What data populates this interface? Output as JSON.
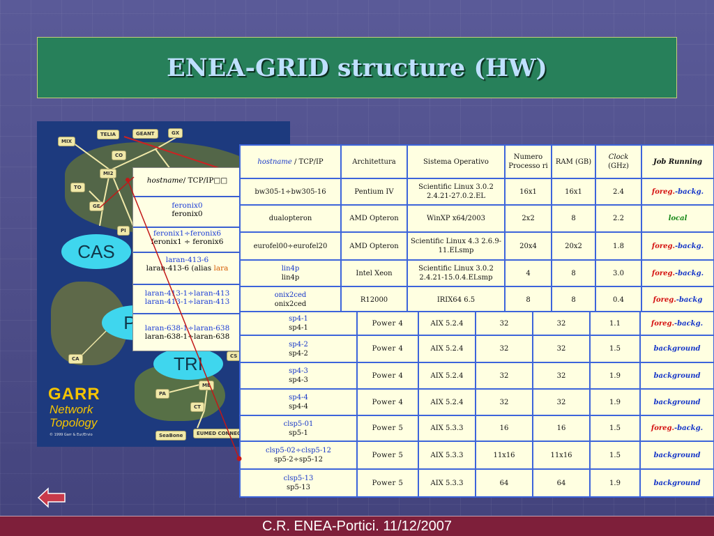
{
  "title": "ENEA-GRID structure (HW)",
  "footer": "C.R. ENEA-Portici. 11/12/2007",
  "map": {
    "nodes": [
      "MIX",
      "TELIA",
      "GEANT",
      "GX",
      "CO",
      "MI2",
      "TO",
      "GE",
      "PI",
      "CA",
      "CS",
      "PA",
      "ME",
      "CT",
      "SeaBone",
      "EUMED CONNECT"
    ],
    "clouds": [
      "CAS",
      "PO",
      "TRI"
    ],
    "garr_title": "GARR",
    "garr_subtitle_1": "Network",
    "garr_subtitle_2": "Topology",
    "copyright": "© 1999 Garr & Eur/Ervio"
  },
  "small_table": {
    "header_italic": "hostname",
    "header_rest": "/ TCP/IP□□",
    "rows": [
      {
        "line1": "feronix0",
        "line2": "feronix0"
      },
      {
        "line1": "feronix1÷feronix6",
        "line2": "feronix1 ÷ feronix6"
      },
      {
        "line1": "laran-413-6",
        "line2_a": "laran-413-6 (alias ",
        "line2_b": "lara"
      },
      {
        "line1": "laran-413-1÷laran-413",
        "line2": "laran-413-1÷laran-413"
      },
      {
        "line1": "laran-638-1÷laran-638",
        "line2": "laran-638-1÷laran-638"
      }
    ]
  },
  "table1": {
    "headers": {
      "hostname_italic": "hostname",
      "hostname_rest": " / TCP/IP",
      "arch": "Architettura",
      "os": "Sistema Operativo",
      "numproc": "Numero Processo ri",
      "ram": "RAM (GB)",
      "clock_italic": "Clock",
      "clock_rest": "(GHz)",
      "job": "Job Running"
    },
    "rows": [
      {
        "host1": "bw305-1÷bw305-16",
        "host2": "",
        "arch": "Pentium IV",
        "os": "Scientific Linux 3.0.2 2.4.21-27.0.2.EL",
        "proc": "16x1",
        "ram": "16x1",
        "clock": "2.4",
        "job_a": "foreg.",
        "job_b": "-backg.",
        "job_type": "fb"
      },
      {
        "host1": "dualopteron",
        "host2": "",
        "arch": "AMD Opteron",
        "os": "WinXP x64/2003",
        "proc": "2x2",
        "ram": "8",
        "clock": "2.2",
        "job_a": "local",
        "job_b": "",
        "job_type": "local"
      },
      {
        "host1": "eurofel00÷eurofel20",
        "host2": "",
        "arch": "AMD Opteron",
        "os": "Scientific Linux 4.3 2.6.9-11.ELsmp",
        "proc": "20x4",
        "ram": "20x2",
        "clock": "1.8",
        "job_a": "foreg.",
        "job_b": "-backg.",
        "job_type": "fb"
      },
      {
        "host1": "lin4p",
        "host2": "lin4p",
        "arch": "Intel Xeon",
        "os": "Scientific Linux 3.0.2 2.4.21-15.0.4.ELsmp",
        "proc": "4",
        "ram": "8",
        "clock": "3.0",
        "job_a": "foreg.",
        "job_b": "-backg.",
        "job_type": "fb"
      },
      {
        "host1": "onix2ced",
        "host2": "onix2ced",
        "arch": "R12000",
        "os": "IRIX64 6.5",
        "proc": "8",
        "ram": "8",
        "clock": "0.4",
        "job_a": "foreg.",
        "job_b": "-backg",
        "job_type": "fb"
      }
    ]
  },
  "table2": {
    "rows": [
      {
        "host1": "sp4-1",
        "host2": "sp4-1",
        "arch": "Power 4",
        "os": "AIX 5.2.4",
        "proc": "32",
        "ram": "32",
        "clock": "1.1",
        "job_a": "foreg.",
        "job_b": "-backg.",
        "job_type": "fb"
      },
      {
        "host1": "sp4-2",
        "host2": "sp4-2",
        "arch": "Power 4",
        "os": "AIX 5.2.4",
        "proc": "32",
        "ram": "32",
        "clock": "1.5",
        "job_a": "background",
        "job_b": "",
        "job_type": "bg"
      },
      {
        "host1": "sp4-3",
        "host2": "sp4-3",
        "arch": "Power 4",
        "os": "AIX 5.2.4",
        "proc": "32",
        "ram": "32",
        "clock": "1.9",
        "job_a": "background",
        "job_b": "",
        "job_type": "bg"
      },
      {
        "host1": "sp4-4",
        "host2": "sp4-4",
        "arch": "Power 4",
        "os": "AIX 5.2.4",
        "proc": "32",
        "ram": "32",
        "clock": "1.9",
        "job_a": "background",
        "job_b": "",
        "job_type": "bg"
      },
      {
        "host1": "clsp5-01",
        "host2": "sp5-1",
        "arch": "Power 5",
        "os": "AIX 5.3.3",
        "proc": "16",
        "ram": "16",
        "clock": "1.5",
        "job_a": "foreg.",
        "job_b": "-backg.",
        "job_type": "fb"
      },
      {
        "host1": "clsp5-02÷clsp5-12",
        "host2": "sp5-2÷sp5-12",
        "arch": "Power 5",
        "os": "AIX 5.3.3",
        "proc": "11x16",
        "ram": "11x16",
        "clock": "1.5",
        "job_a": "background",
        "job_b": "",
        "job_type": "bg"
      },
      {
        "host1": "clsp5-13",
        "host2": "sp5-13",
        "arch": "Power 5",
        "os": "AIX 5.3.3",
        "proc": "64",
        "ram": "64",
        "clock": "1.9",
        "job_a": "background",
        "job_b": "",
        "job_type": "bg"
      }
    ]
  },
  "colors": {
    "title_bg": "#27805a",
    "title_text": "#bfe0ff",
    "table_border": "#3c64da",
    "footer_bg": "#7e1f3a"
  },
  "icons": {
    "back": "back-arrow-icon"
  }
}
